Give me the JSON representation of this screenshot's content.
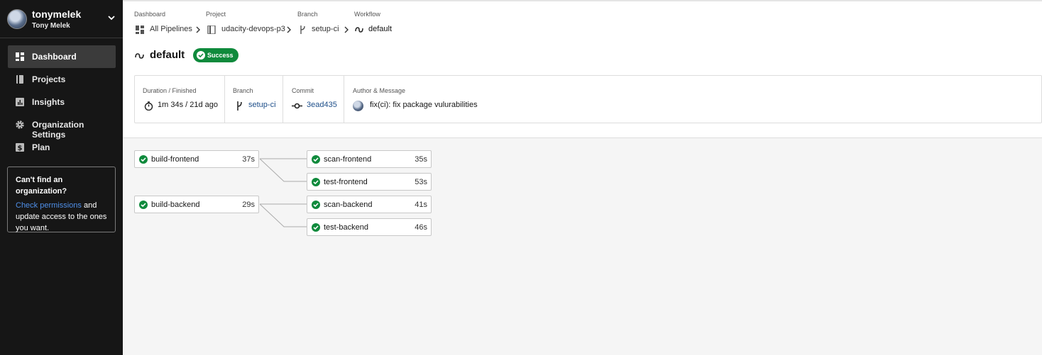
{
  "sidebar": {
    "username": "tonymelek",
    "fullname": "Tony Melek",
    "nav": [
      {
        "label": "Dashboard",
        "icon": "dashboard-icon",
        "active": true
      },
      {
        "label": "Projects",
        "icon": "projects-icon",
        "active": false
      },
      {
        "label": "Insights",
        "icon": "insights-icon",
        "active": false
      },
      {
        "label": "Organization Settings",
        "icon": "gear-icon",
        "active": false
      },
      {
        "label": "Plan",
        "icon": "dollar-icon",
        "active": false
      }
    ],
    "org_box": {
      "title": "Can't find an organization?",
      "link": "Check permissions",
      "text_after_link": " and update access to the ones you want."
    }
  },
  "breadcrumb": {
    "dashboard": {
      "label": "Dashboard",
      "value": "All Pipelines"
    },
    "project": {
      "label": "Project",
      "value": "udacity-devops-p3"
    },
    "branch": {
      "label": "Branch",
      "value": "setup-ci"
    },
    "workflow": {
      "label": "Workflow",
      "value": "default"
    }
  },
  "workflow": {
    "title": "default",
    "status": "Success",
    "status_color": "#0f8a3c"
  },
  "details": {
    "duration": {
      "label": "Duration / Finished",
      "value": "1m 34s / 21d ago"
    },
    "branch": {
      "label": "Branch",
      "value": "setup-ci"
    },
    "commit": {
      "label": "Commit",
      "value": "3ead435"
    },
    "author": {
      "label": "Author & Message",
      "value": "fix(ci): fix package vulurabilities"
    }
  },
  "jobs": [
    {
      "name": "build-frontend",
      "duration": "37s",
      "status": "success"
    },
    {
      "name": "scan-frontend",
      "duration": "35s",
      "status": "success"
    },
    {
      "name": "test-frontend",
      "duration": "53s",
      "status": "success"
    },
    {
      "name": "build-backend",
      "duration": "29s",
      "status": "success"
    },
    {
      "name": "scan-backend",
      "duration": "41s",
      "status": "success"
    },
    {
      "name": "test-backend",
      "duration": "46s",
      "status": "success"
    }
  ]
}
